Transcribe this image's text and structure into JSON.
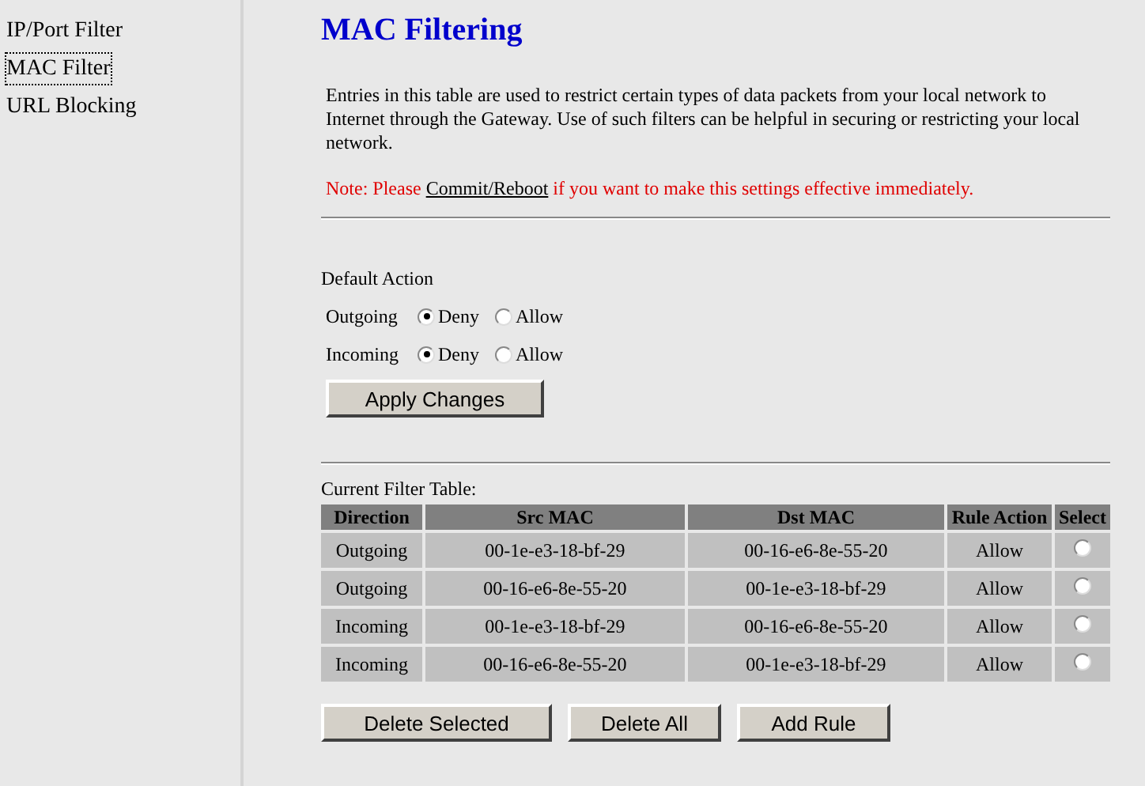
{
  "sidebar": {
    "items": [
      {
        "label": "IP/Port Filter",
        "selected": false
      },
      {
        "label": "MAC Filter",
        "selected": true
      },
      {
        "label": "URL Blocking",
        "selected": false
      }
    ]
  },
  "title": "MAC Filtering",
  "description": "Entries in this table are used to restrict certain types of data packets from your local network to Internet through the Gateway. Use of such filters can be helpful in securing or restricting your local network.",
  "note": {
    "before": "Note: Please ",
    "link": "Commit/Reboot",
    "after": " if you want to make this settings effective immediately."
  },
  "default_action": {
    "label": "Default Action",
    "rows": [
      {
        "label": "Outgoing",
        "options": [
          {
            "label": "Deny",
            "selected": true
          },
          {
            "label": "Allow",
            "selected": false
          }
        ]
      },
      {
        "label": "Incoming",
        "options": [
          {
            "label": "Deny",
            "selected": true
          },
          {
            "label": "Allow",
            "selected": false
          }
        ]
      }
    ]
  },
  "apply_button": "Apply Changes",
  "table": {
    "caption": "Current Filter Table:",
    "columns": [
      "Direction",
      "Src MAC",
      "Dst MAC",
      "Rule Action",
      "Select"
    ],
    "rows": [
      {
        "direction": "Outgoing",
        "src": "00-1e-e3-18-bf-29",
        "dst": "00-16-e6-8e-55-20",
        "action": "Allow",
        "selected": false
      },
      {
        "direction": "Outgoing",
        "src": "00-16-e6-8e-55-20",
        "dst": "00-1e-e3-18-bf-29",
        "action": "Allow",
        "selected": false
      },
      {
        "direction": "Incoming",
        "src": "00-1e-e3-18-bf-29",
        "dst": "00-16-e6-8e-55-20",
        "action": "Allow",
        "selected": false
      },
      {
        "direction": "Incoming",
        "src": "00-16-e6-8e-55-20",
        "dst": "00-1e-e3-18-bf-29",
        "action": "Allow",
        "selected": false
      }
    ]
  },
  "buttons": [
    "Delete Selected",
    "Delete All",
    "Add Rule"
  ]
}
